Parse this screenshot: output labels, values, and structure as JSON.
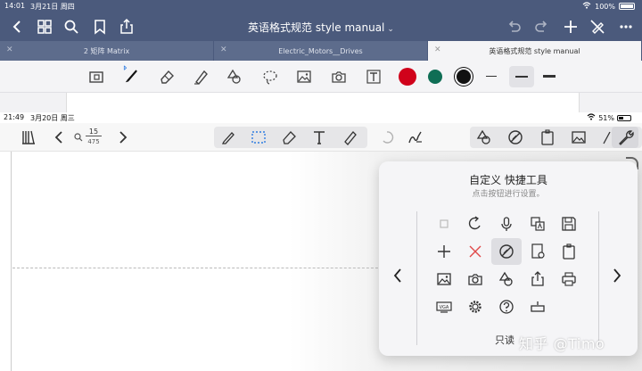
{
  "status_top": {
    "time": "14:01",
    "date": "3月21日 周四",
    "battery": "100%"
  },
  "nav": {
    "title": "英语格式规范 style manual",
    "caret": "⌄"
  },
  "tabs": [
    {
      "label": "2 矩阵 Matrix",
      "active": false
    },
    {
      "label": "Electric_Motors__Drives",
      "active": false
    },
    {
      "label": "英语格式规范 style manual",
      "active": true
    }
  ],
  "pen_toolbar": {
    "colors": [
      "#d0021b",
      "#0f6e55",
      "#111111"
    ],
    "icons": [
      "zoom-icon",
      "bluetooth-pen-icon",
      "eraser-icon",
      "highlighter-icon",
      "shapes-icon",
      "lasso-icon",
      "image-icon",
      "camera-icon",
      "text-box-icon"
    ]
  },
  "status_second": {
    "time": "21:49",
    "date": "3月20日 周三",
    "battery": "51%"
  },
  "page_indicator": {
    "current": "15",
    "total": "475"
  },
  "popup": {
    "title": "自定义 快捷工具",
    "subtitle": "点击按钮进行设置。",
    "readonly_label": "只读"
  },
  "watermark": "知乎 @Timo"
}
